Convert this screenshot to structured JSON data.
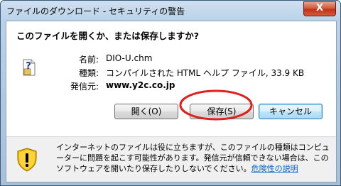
{
  "window": {
    "title": "ファイルのダウンロード - セキュリティの警告",
    "close_glyph": "X"
  },
  "dialog": {
    "heading": "このファイルを開くか、または保存しますか?",
    "file_info": {
      "name_label": "名前:",
      "name_value": "DIO-U.chm",
      "type_label": "種類:",
      "type_value": "コンパイルされた HTML ヘルプ ファイル, 33.9 KB",
      "source_label": "発信元:",
      "source_value": "www.y2c.co.jp"
    },
    "buttons": {
      "open": "開く(O)",
      "save": "保存(S)",
      "cancel": "キャンセル"
    },
    "warning": {
      "text": "インターネットのファイルは役に立ちますが、このファイルの種類はコンピューターに問題を起こす可能性があります。発信元が信頼できない場合は、このソフトウェアを開いたり保存したりしないでください。",
      "link": "危険性の説明"
    }
  },
  "colors": {
    "annotation_ellipse": "#e0201c",
    "link": "#0066cc"
  },
  "icons": {
    "file": "unknown-file-icon",
    "shield": "warning-shield-icon"
  }
}
